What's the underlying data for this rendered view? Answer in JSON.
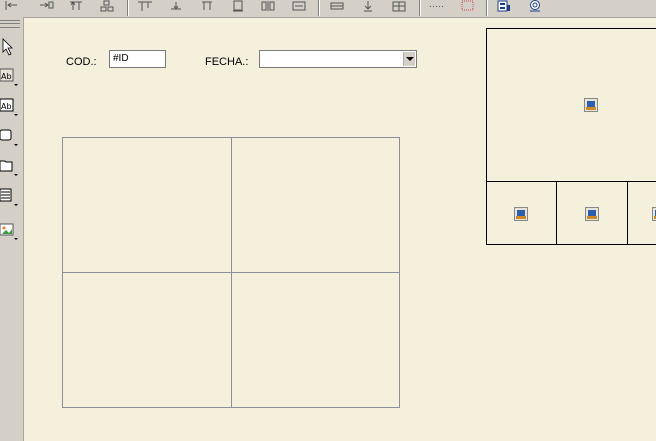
{
  "toolbar": {
    "icons": [
      "align-left-icon",
      "align-center-h-icon",
      "align-top-icon",
      "distribute-icon",
      "align-top-edges-icon",
      "align-bottom-edges-icon",
      "same-width-icon",
      "same-height-icon",
      "center-horizontal-icon",
      "center-vertical-icon",
      "move-up-icon",
      "move-down-icon",
      "bring-front-icon",
      "grid-icon",
      "selection-box-icon",
      "object-properties-icon",
      "preview-icon"
    ]
  },
  "left_toolbar": {
    "tools": [
      "pointer-icon",
      "label-tool-icon",
      "textbox-tool-icon",
      "rectangle-tool-icon",
      "folder-tool-icon",
      "list-tool-icon",
      "image-tool-icon"
    ]
  },
  "form": {
    "cod_label": "COD.:",
    "cod_value": "#ID",
    "fecha_label": "FECHA.:",
    "fecha_value": ""
  },
  "colors": {
    "canvas_background": "#f4f0dc",
    "toolbar_background": "#d4d0c8",
    "grid_lines": "#8a8f9a"
  }
}
